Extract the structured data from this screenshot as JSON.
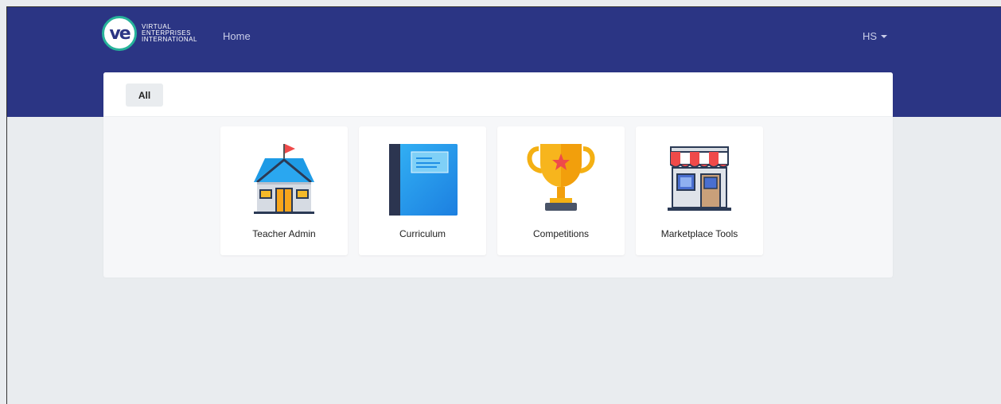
{
  "brand": {
    "logo_mark": "ve",
    "logo_lines": [
      "VIRTUAL",
      "ENTERPRISES",
      "INTERNATIONAL"
    ]
  },
  "nav": {
    "home_label": "Home",
    "user_initials": "HS"
  },
  "filter": {
    "all_label": "All"
  },
  "tiles": [
    {
      "label": "Teacher Admin",
      "icon": "school-icon"
    },
    {
      "label": "Curriculum",
      "icon": "book-icon"
    },
    {
      "label": "Competitions",
      "icon": "trophy-icon"
    },
    {
      "label": "Marketplace Tools",
      "icon": "store-icon"
    }
  ],
  "colors": {
    "navbar": "#2b3584",
    "page_bg": "#e9ecef",
    "logo_ring": "#27b39a"
  }
}
